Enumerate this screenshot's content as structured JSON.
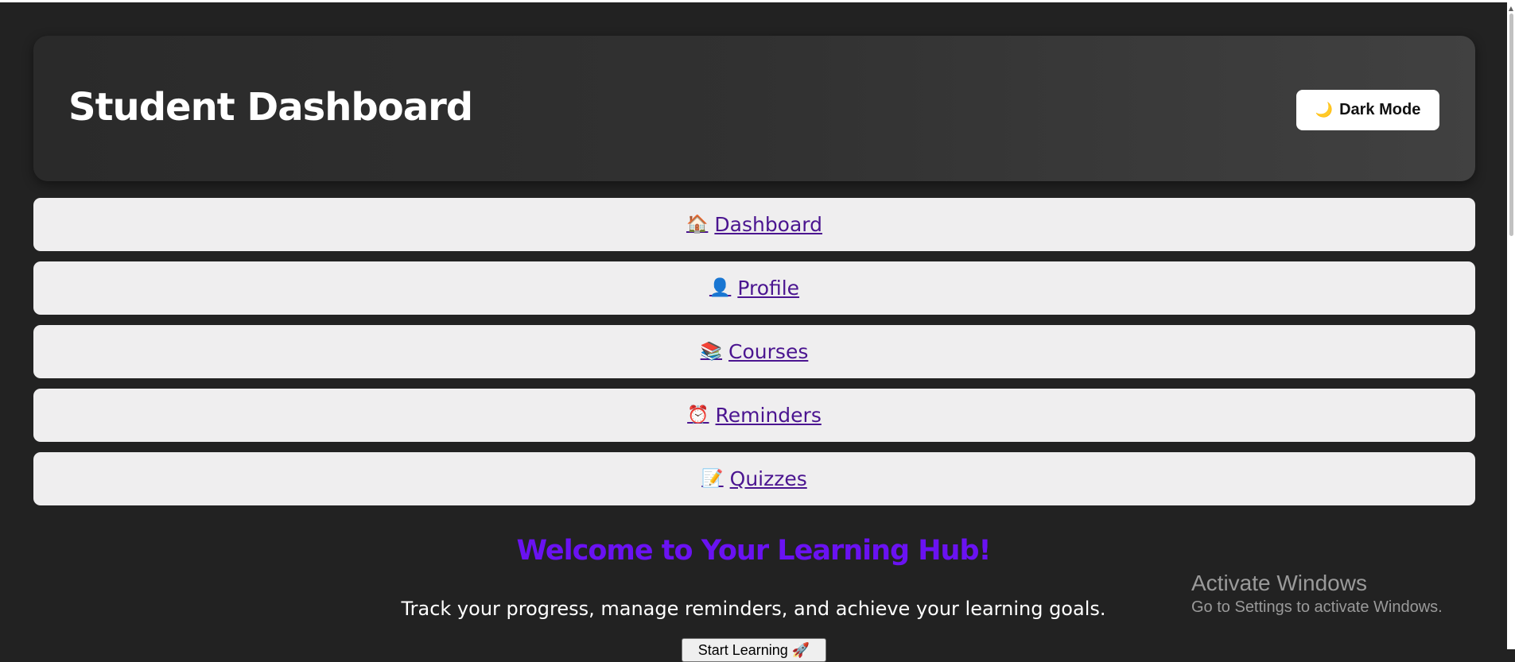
{
  "header": {
    "title": "Student Dashboard",
    "mode_icon": "🌙",
    "mode_label": "Dark Mode"
  },
  "nav": {
    "items": [
      {
        "icon": "🏠",
        "label": "Dashboard"
      },
      {
        "icon": "👤",
        "label": "Profile"
      },
      {
        "icon": "📚",
        "label": "Courses"
      },
      {
        "icon": "⏰",
        "label": "Reminders"
      },
      {
        "icon": "📝",
        "label": "Quizzes"
      }
    ]
  },
  "main": {
    "welcome": "Welcome to Your Learning Hub!",
    "subtitle": "Track your progress, manage reminders, and achieve your learning goals.",
    "start_label": "Start Learning 🚀"
  },
  "watermark": {
    "line1": "Activate Windows",
    "line2": "Go to Settings to activate Windows."
  },
  "colors": {
    "background": "#222222",
    "nav_bg": "#efeeef",
    "link": "#4b1590",
    "welcome": "#6a12f2"
  }
}
